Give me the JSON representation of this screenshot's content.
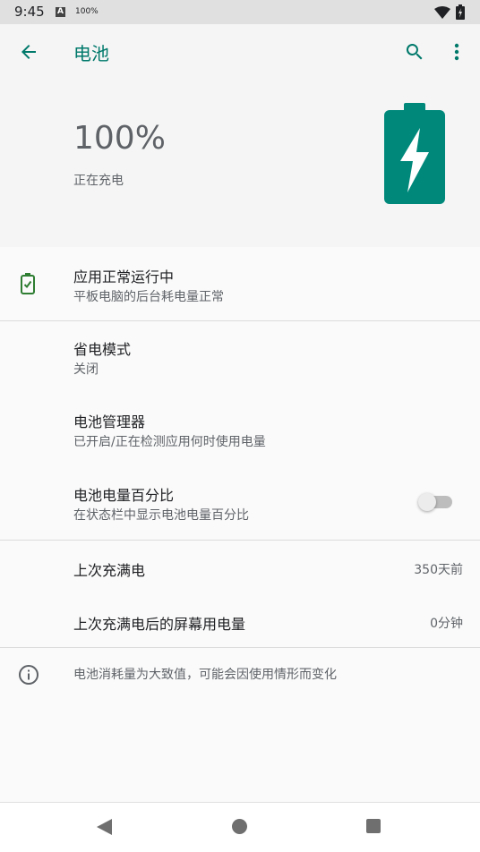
{
  "status_bar": {
    "time": "9:45",
    "notification_glyph": "A",
    "battery_percent_label": "100%",
    "icons": [
      "app-notification-icon",
      "wifi-icon",
      "battery-charging-icon"
    ]
  },
  "app_bar": {
    "title": "电池",
    "icons": [
      "back-arrow-icon",
      "search-icon",
      "more-vert-icon"
    ]
  },
  "header": {
    "level": "100%",
    "state": "正在充电",
    "icon": "battery-charging-icon",
    "accent_color": "#00897b"
  },
  "status_tip": {
    "title": "应用正常运行中",
    "summary": "平板电脑的后台耗电量正常",
    "icon": "battery-check-icon"
  },
  "settings": [
    {
      "title": "省电模式",
      "summary": "关闭"
    },
    {
      "title": "电池管理器",
      "summary": "已开启/正在检测应用何时使用电量"
    },
    {
      "title": "电池电量百分比",
      "summary": "在状态栏中显示电池电量百分比",
      "toggle_on": false
    }
  ],
  "stats": [
    {
      "title": "上次充满电",
      "value": "350天前"
    },
    {
      "title": "上次充满电后的屏幕用电量",
      "value": "0分钟"
    }
  ],
  "footer": {
    "text": "电池消耗量为大致值，可能会因使用情形而变化",
    "icon": "info-icon"
  },
  "nav_bar": {
    "icons": [
      "nav-back-icon",
      "nav-home-icon",
      "nav-recents-icon"
    ]
  }
}
